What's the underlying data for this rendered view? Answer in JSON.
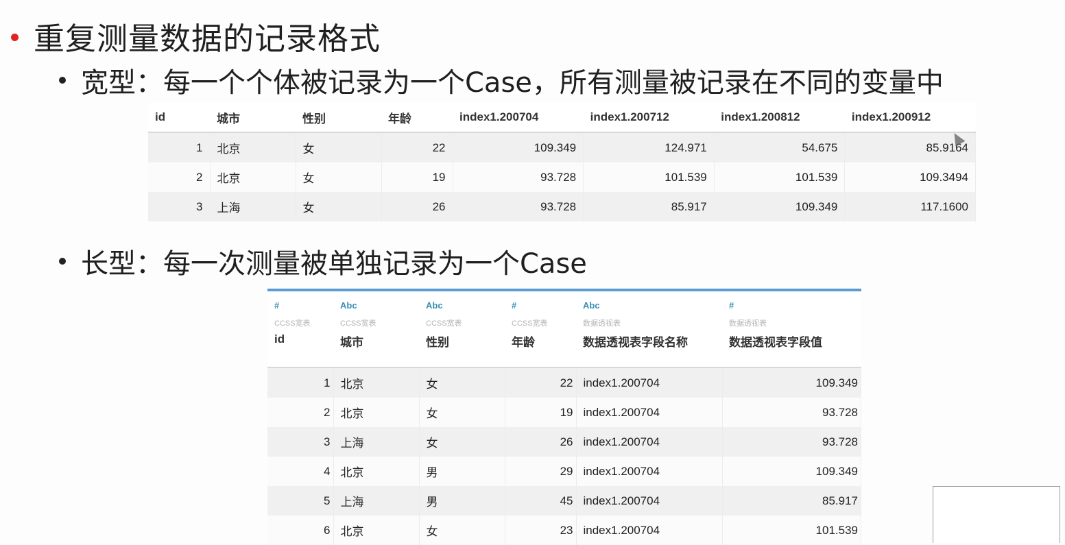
{
  "title": "重复测量数据的记录格式",
  "wide_section": {
    "heading": "宽型：每一个个体被记录为一个Case，所有测量被记录在不同的变量中",
    "columns": [
      "id",
      "城市",
      "性别",
      "年龄",
      "index1.200704",
      "index1.200712",
      "index1.200812",
      "index1.200912"
    ],
    "rows": [
      [
        "1",
        "北京",
        "女",
        "22",
        "109.349",
        "124.971",
        "54.675",
        "85.9164"
      ],
      [
        "2",
        "北京",
        "女",
        "19",
        "93.728",
        "101.539",
        "101.539",
        "109.3494"
      ],
      [
        "3",
        "上海",
        "女",
        "26",
        "93.728",
        "85.917",
        "109.349",
        "117.1600"
      ]
    ]
  },
  "long_section": {
    "heading": "长型：每一次测量被单独记录为一个Case",
    "columns": [
      {
        "type": "#",
        "source": "CCSS宽表",
        "name": "id"
      },
      {
        "type": "Abc",
        "source": "CCSS宽表",
        "name": "城市"
      },
      {
        "type": "Abc",
        "source": "CCSS宽表",
        "name": "性别"
      },
      {
        "type": "#",
        "source": "CCSS宽表",
        "name": "年龄"
      },
      {
        "type": "Abc",
        "source": "数据透视表",
        "name": "数据透视表字段名称"
      },
      {
        "type": "#",
        "source": "数据透视表",
        "name": "数据透视表字段值"
      }
    ],
    "rows": [
      [
        "1",
        "北京",
        "女",
        "22",
        "index1.200704",
        "109.349"
      ],
      [
        "2",
        "北京",
        "女",
        "19",
        "index1.200704",
        "93.728"
      ],
      [
        "3",
        "上海",
        "女",
        "26",
        "index1.200704",
        "93.728"
      ],
      [
        "4",
        "北京",
        "男",
        "29",
        "index1.200704",
        "109.349"
      ],
      [
        "5",
        "上海",
        "男",
        "45",
        "index1.200704",
        "85.917"
      ],
      [
        "6",
        "北京",
        "女",
        "23",
        "index1.200704",
        "101.539"
      ]
    ]
  },
  "colors": {
    "bullet_red": "#e02424",
    "header_accent": "#5a9bd3",
    "type_icon": "#3a8fb7"
  }
}
